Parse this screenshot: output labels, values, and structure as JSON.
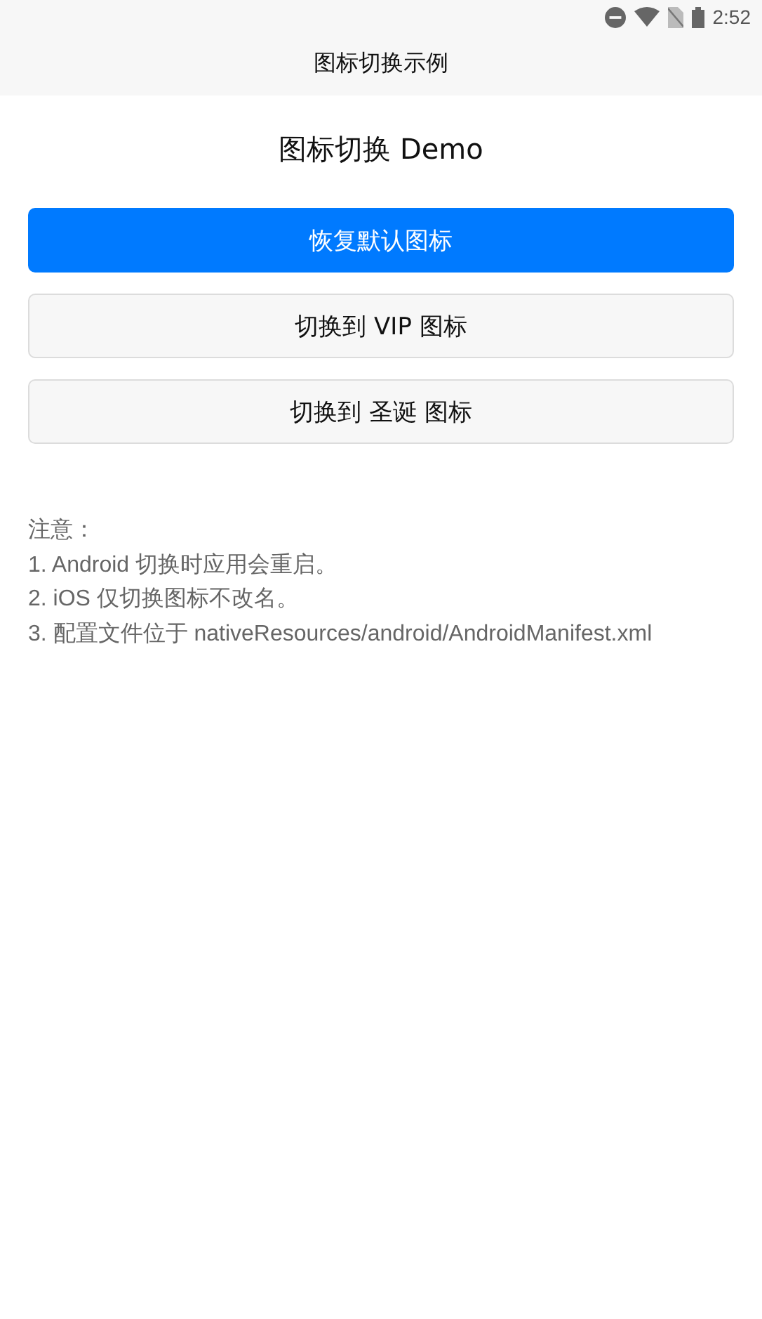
{
  "status_bar": {
    "time": "2:52"
  },
  "nav_bar": {
    "title": "图标切换示例"
  },
  "heading": "图标切换 Demo",
  "buttons": [
    {
      "label": "恢复默认图标",
      "kind": "primary"
    },
    {
      "label": "切换到 VIP 图标",
      "kind": "secondary"
    },
    {
      "label": "切换到 圣诞 图标",
      "kind": "secondary"
    }
  ],
  "notes": [
    "注意：",
    "1. Android 切换时应用会重启。",
    "2. iOS 仅切换图标不改名。",
    "3. 配置文件位于 nativeResources/android/AndroidManifest.xml"
  ]
}
